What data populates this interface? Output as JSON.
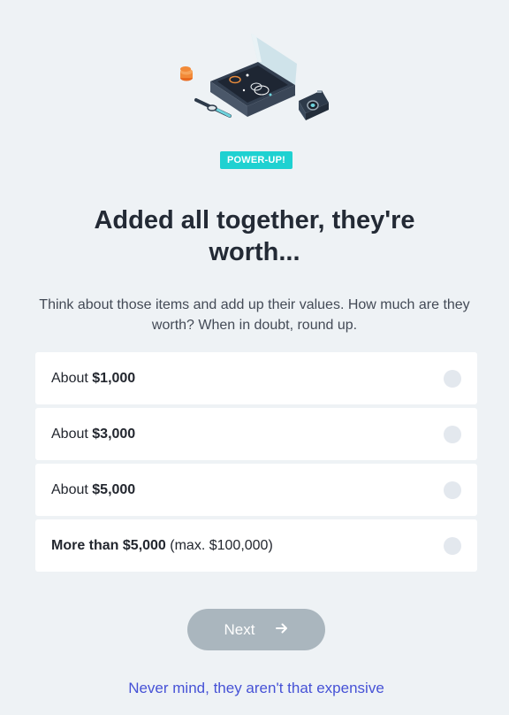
{
  "header": {
    "badge_label": "POWER-UP!",
    "title": "Added all together, they're worth...",
    "subtitle": "Think about those items and add up their values. How much are they worth? When in doubt, round up."
  },
  "options": [
    {
      "prefix": "About ",
      "amount": "$1,000",
      "suffix": ""
    },
    {
      "prefix": "About ",
      "amount": "$3,000",
      "suffix": ""
    },
    {
      "prefix": "About ",
      "amount": "$5,000",
      "suffix": ""
    },
    {
      "prefix": "",
      "amount": "More than $5,000",
      "suffix": " (max. $100,000)"
    }
  ],
  "actions": {
    "next_label": "Next",
    "next_icon": "arrow-right-icon",
    "nevermind_label": "Never mind, they aren't that expensive"
  },
  "colors": {
    "background": "#eef2f5",
    "badge": "#1fd1d1",
    "button_disabled": "#aab6be",
    "link": "#4652d6"
  },
  "illustration": {
    "name": "valuables-illustration",
    "items": [
      "jewelry-box-icon",
      "coins-icon",
      "watch-icon",
      "camera-icon"
    ]
  }
}
